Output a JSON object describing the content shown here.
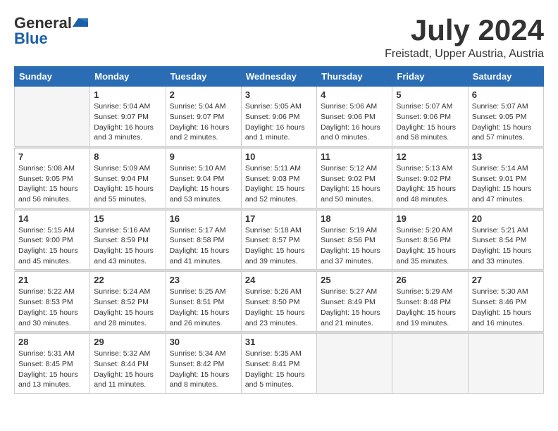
{
  "header": {
    "logo_general": "General",
    "logo_blue": "Blue",
    "month": "July 2024",
    "location": "Freistadt, Upper Austria, Austria"
  },
  "weekdays": [
    "Sunday",
    "Monday",
    "Tuesday",
    "Wednesday",
    "Thursday",
    "Friday",
    "Saturday"
  ],
  "weeks": [
    [
      {
        "day": "",
        "info": ""
      },
      {
        "day": "1",
        "info": "Sunrise: 5:04 AM\nSunset: 9:07 PM\nDaylight: 16 hours\nand 3 minutes."
      },
      {
        "day": "2",
        "info": "Sunrise: 5:04 AM\nSunset: 9:07 PM\nDaylight: 16 hours\nand 2 minutes."
      },
      {
        "day": "3",
        "info": "Sunrise: 5:05 AM\nSunset: 9:06 PM\nDaylight: 16 hours\nand 1 minute."
      },
      {
        "day": "4",
        "info": "Sunrise: 5:06 AM\nSunset: 9:06 PM\nDaylight: 16 hours\nand 0 minutes."
      },
      {
        "day": "5",
        "info": "Sunrise: 5:07 AM\nSunset: 9:06 PM\nDaylight: 15 hours\nand 58 minutes."
      },
      {
        "day": "6",
        "info": "Sunrise: 5:07 AM\nSunset: 9:05 PM\nDaylight: 15 hours\nand 57 minutes."
      }
    ],
    [
      {
        "day": "7",
        "info": "Sunrise: 5:08 AM\nSunset: 9:05 PM\nDaylight: 15 hours\nand 56 minutes."
      },
      {
        "day": "8",
        "info": "Sunrise: 5:09 AM\nSunset: 9:04 PM\nDaylight: 15 hours\nand 55 minutes."
      },
      {
        "day": "9",
        "info": "Sunrise: 5:10 AM\nSunset: 9:04 PM\nDaylight: 15 hours\nand 53 minutes."
      },
      {
        "day": "10",
        "info": "Sunrise: 5:11 AM\nSunset: 9:03 PM\nDaylight: 15 hours\nand 52 minutes."
      },
      {
        "day": "11",
        "info": "Sunrise: 5:12 AM\nSunset: 9:02 PM\nDaylight: 15 hours\nand 50 minutes."
      },
      {
        "day": "12",
        "info": "Sunrise: 5:13 AM\nSunset: 9:02 PM\nDaylight: 15 hours\nand 48 minutes."
      },
      {
        "day": "13",
        "info": "Sunrise: 5:14 AM\nSunset: 9:01 PM\nDaylight: 15 hours\nand 47 minutes."
      }
    ],
    [
      {
        "day": "14",
        "info": "Sunrise: 5:15 AM\nSunset: 9:00 PM\nDaylight: 15 hours\nand 45 minutes."
      },
      {
        "day": "15",
        "info": "Sunrise: 5:16 AM\nSunset: 8:59 PM\nDaylight: 15 hours\nand 43 minutes."
      },
      {
        "day": "16",
        "info": "Sunrise: 5:17 AM\nSunset: 8:58 PM\nDaylight: 15 hours\nand 41 minutes."
      },
      {
        "day": "17",
        "info": "Sunrise: 5:18 AM\nSunset: 8:57 PM\nDaylight: 15 hours\nand 39 minutes."
      },
      {
        "day": "18",
        "info": "Sunrise: 5:19 AM\nSunset: 8:56 PM\nDaylight: 15 hours\nand 37 minutes."
      },
      {
        "day": "19",
        "info": "Sunrise: 5:20 AM\nSunset: 8:56 PM\nDaylight: 15 hours\nand 35 minutes."
      },
      {
        "day": "20",
        "info": "Sunrise: 5:21 AM\nSunset: 8:54 PM\nDaylight: 15 hours\nand 33 minutes."
      }
    ],
    [
      {
        "day": "21",
        "info": "Sunrise: 5:22 AM\nSunset: 8:53 PM\nDaylight: 15 hours\nand 30 minutes."
      },
      {
        "day": "22",
        "info": "Sunrise: 5:24 AM\nSunset: 8:52 PM\nDaylight: 15 hours\nand 28 minutes."
      },
      {
        "day": "23",
        "info": "Sunrise: 5:25 AM\nSunset: 8:51 PM\nDaylight: 15 hours\nand 26 minutes."
      },
      {
        "day": "24",
        "info": "Sunrise: 5:26 AM\nSunset: 8:50 PM\nDaylight: 15 hours\nand 23 minutes."
      },
      {
        "day": "25",
        "info": "Sunrise: 5:27 AM\nSunset: 8:49 PM\nDaylight: 15 hours\nand 21 minutes."
      },
      {
        "day": "26",
        "info": "Sunrise: 5:29 AM\nSunset: 8:48 PM\nDaylight: 15 hours\nand 19 minutes."
      },
      {
        "day": "27",
        "info": "Sunrise: 5:30 AM\nSunset: 8:46 PM\nDaylight: 15 hours\nand 16 minutes."
      }
    ],
    [
      {
        "day": "28",
        "info": "Sunrise: 5:31 AM\nSunset: 8:45 PM\nDaylight: 15 hours\nand 13 minutes."
      },
      {
        "day": "29",
        "info": "Sunrise: 5:32 AM\nSunset: 8:44 PM\nDaylight: 15 hours\nand 11 minutes."
      },
      {
        "day": "30",
        "info": "Sunrise: 5:34 AM\nSunset: 8:42 PM\nDaylight: 15 hours\nand 8 minutes."
      },
      {
        "day": "31",
        "info": "Sunrise: 5:35 AM\nSunset: 8:41 PM\nDaylight: 15 hours\nand 5 minutes."
      },
      {
        "day": "",
        "info": ""
      },
      {
        "day": "",
        "info": ""
      },
      {
        "day": "",
        "info": ""
      }
    ]
  ]
}
